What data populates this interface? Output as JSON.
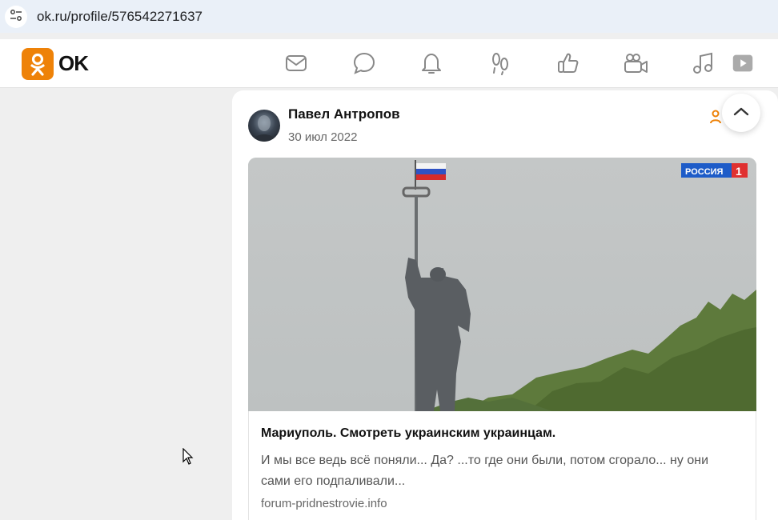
{
  "browser": {
    "url": "ok.ru/profile/576542271637",
    "site_info_icon": "tune-icon"
  },
  "header": {
    "logo_text": "OK",
    "brand_color": "#ee8208",
    "nav_icons": [
      "mail-icon",
      "chat-icon",
      "bell-icon",
      "footprints-icon",
      "like-icon",
      "video-camera-icon",
      "music-icon",
      "video-icon"
    ]
  },
  "post": {
    "author": "Павел Антропов",
    "date": "30 июл 2022",
    "channel_logo": "РОССИЯ 1",
    "link": {
      "title": "Мариуполь. Смотреть украинским украинцам.",
      "description": "И мы все ведь всё поняли... Да? ...то где они были, потом сгорало... ну они сами его подпаливали...",
      "domain": "forum-pridnestrovie.info"
    }
  }
}
